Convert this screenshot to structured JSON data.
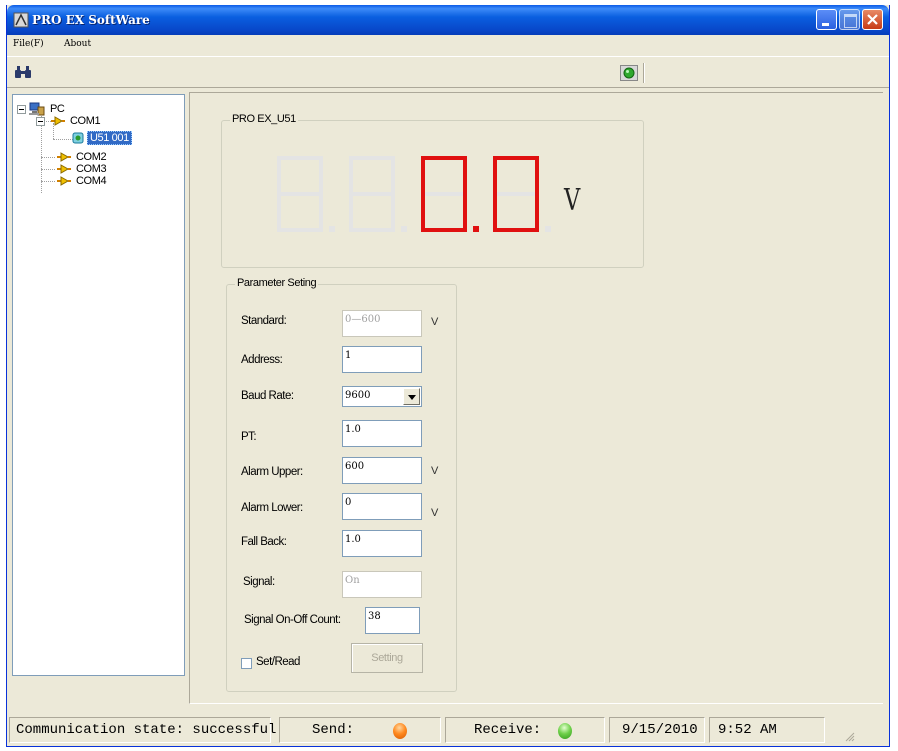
{
  "window": {
    "title": "PRO EX SoftWare"
  },
  "menu": {
    "file": "File(F)",
    "about": "About"
  },
  "tree": {
    "root": "PC",
    "ports": [
      {
        "label": "COM1",
        "devices": [
          "U51 001"
        ]
      },
      {
        "label": "COM2"
      },
      {
        "label": "COM3"
      },
      {
        "label": "COM4"
      }
    ]
  },
  "display": {
    "title": "PRO EX_U51",
    "digits": [
      "",
      "",
      "0",
      "0"
    ],
    "unit": "V",
    "active_color": "#e01010",
    "inactive_color": "#e4e4e4"
  },
  "params": {
    "title": "Parameter Seting",
    "standard": {
      "label": "Standard:",
      "value": "0—600",
      "unit": "V"
    },
    "address": {
      "label": "Address:",
      "value": "1"
    },
    "baud_rate": {
      "label": "Baud Rate:",
      "value": "9600"
    },
    "pt": {
      "label": "PT:",
      "value": "1.0"
    },
    "alarm_upper": {
      "label": "Alarm Upper:",
      "value": "600",
      "unit": "V"
    },
    "alarm_lower": {
      "label": "Alarm Lower:",
      "value": "0",
      "unit": "V"
    },
    "fall_back": {
      "label": "Fall Back:",
      "value": "1.0"
    },
    "signal": {
      "label": "Signal:",
      "value": "On"
    },
    "signal_count": {
      "label": "Signal On-Off Count:",
      "value": "38"
    },
    "set_read": {
      "label": "Set/Read",
      "checked": false
    },
    "setting_button": "Setting"
  },
  "status": {
    "communication": "Communication state: successful",
    "send": "Send:",
    "receive": "Receive:",
    "date": "9/15/2010",
    "time": "9:52 AM",
    "send_led": "orange",
    "receive_led": "green"
  }
}
